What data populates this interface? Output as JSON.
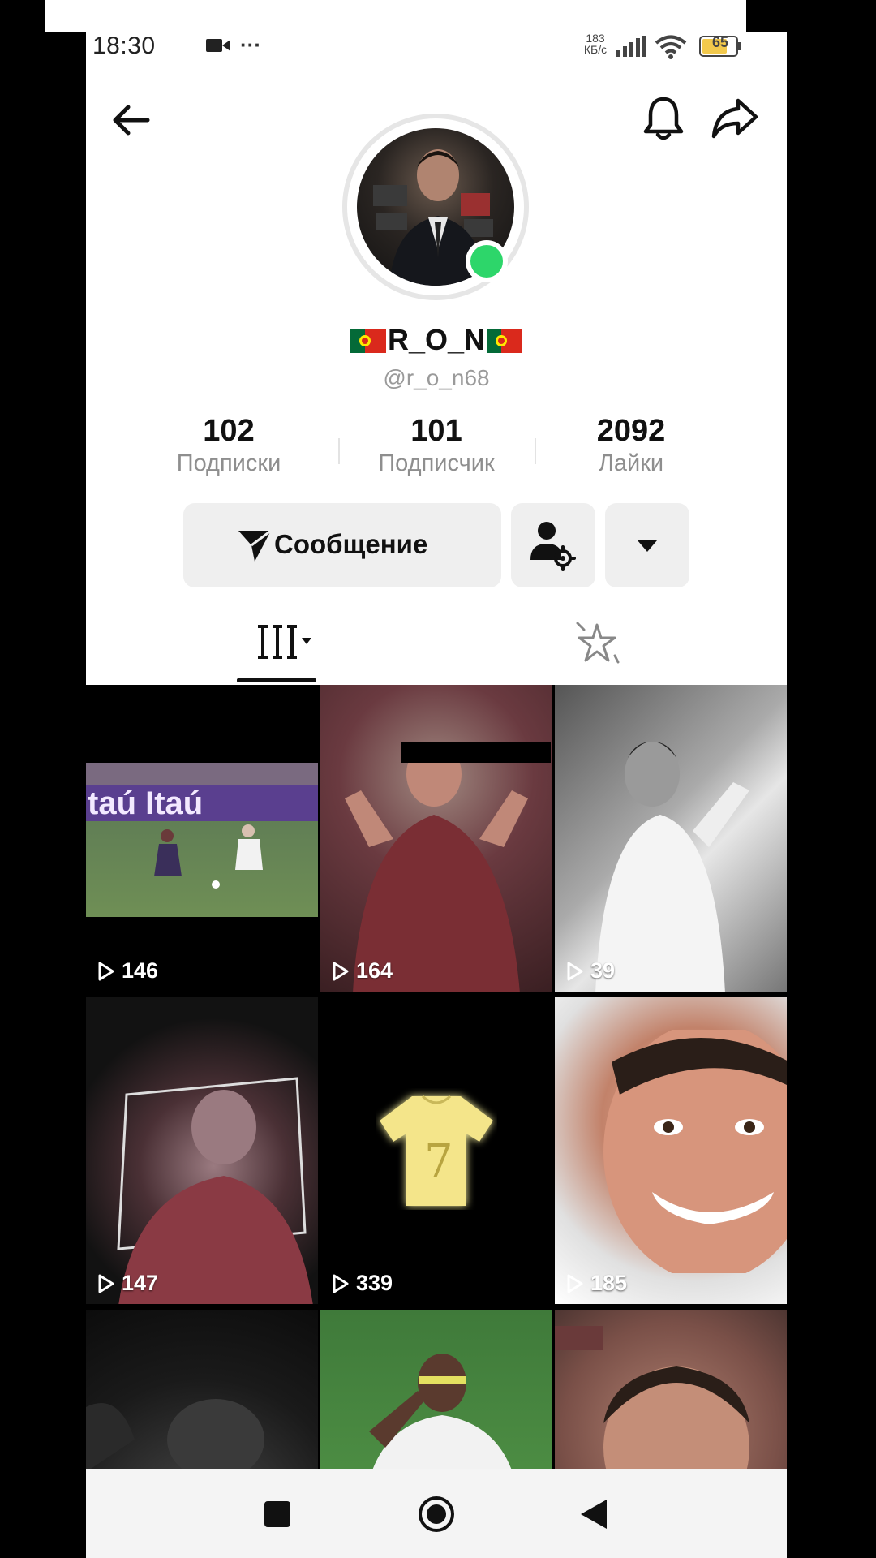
{
  "status_bar": {
    "time": "18:30",
    "more": "···",
    "speed_top": "183",
    "speed_unit": "КБ/с",
    "battery": "65"
  },
  "profile": {
    "display_name": "R_O_N",
    "username": "@r_o_n68",
    "flag_colors": {
      "green": "#046a38",
      "red": "#da291c",
      "yellow": "#ffe900"
    },
    "online_badge_color": "#2dd66a"
  },
  "stats": [
    {
      "value": "102",
      "label": "Подписки"
    },
    {
      "value": "101",
      "label": "Подписчик"
    },
    {
      "value": "2092",
      "label": "Лайки"
    }
  ],
  "actions": {
    "message_label": "Сообщение",
    "message_icon": "send-icon",
    "friends_icon": "user-settings-icon",
    "more_icon": "caret-down-icon"
  },
  "tabs": {
    "videos_icon": "grid-bars-icon",
    "liked_icon": "sparkle-icon"
  },
  "videos": [
    {
      "views": "146"
    },
    {
      "views": "164"
    },
    {
      "views": "39"
    },
    {
      "views": "147"
    },
    {
      "views": "339"
    },
    {
      "views": "185"
    },
    {
      "views": ""
    },
    {
      "views": ""
    },
    {
      "views": ""
    }
  ],
  "thumb_text": {
    "banner": "taú Itaú",
    "jersey_number": "7"
  },
  "nav": {
    "recents_icon": "square-icon",
    "home_icon": "circle-icon",
    "back_icon": "triangle-back-icon"
  }
}
